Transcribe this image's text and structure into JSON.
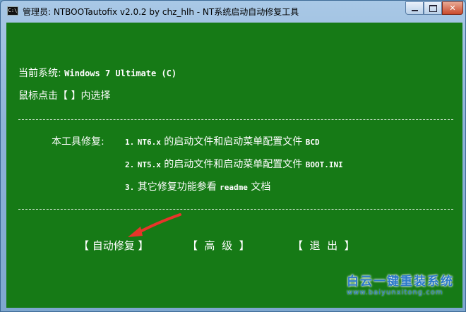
{
  "window": {
    "title": "管理员:  NTBOOTautofix v2.0.2 by chz_hlh - NT系统启动自动修复工具",
    "icon": "console-icon",
    "controls": {
      "minimize": "minimize-icon",
      "maximize": "maximize-icon",
      "close": "close-icon"
    }
  },
  "console": {
    "current_system_label": "当前系统:",
    "current_system_value": "Windows 7 Ultimate  (C)",
    "instruction": "鼠标点击【 】内选择",
    "separator": "--------------------------------------------------------------------------------",
    "tool_label": "本工具修复:",
    "items": [
      {
        "num": "1.",
        "mono": "NT6.x",
        "text": " 的启动文件和启动菜单配置文件 ",
        "suffix": "BCD"
      },
      {
        "num": "2.",
        "mono": "NT5.x",
        "text": " 的启动文件和启动菜单配置文件 ",
        "suffix": "BOOT.INI"
      },
      {
        "num": "3.",
        "text": "其它修复功能参看 ",
        "mono": "readme",
        "suffix": " 文档"
      }
    ],
    "menu": {
      "auto_repair": "【 自动修复 】",
      "advanced": "【  高  级  】",
      "exit": "【  退  出  】"
    }
  },
  "watermark": {
    "line1": "白云一键重装系统",
    "line2": "www.baiyunxitong.com"
  },
  "colors": {
    "console_bg": "#167a16",
    "text": "#ffffff",
    "arrow": "#e8342a",
    "watermark": "#2a78c8"
  }
}
